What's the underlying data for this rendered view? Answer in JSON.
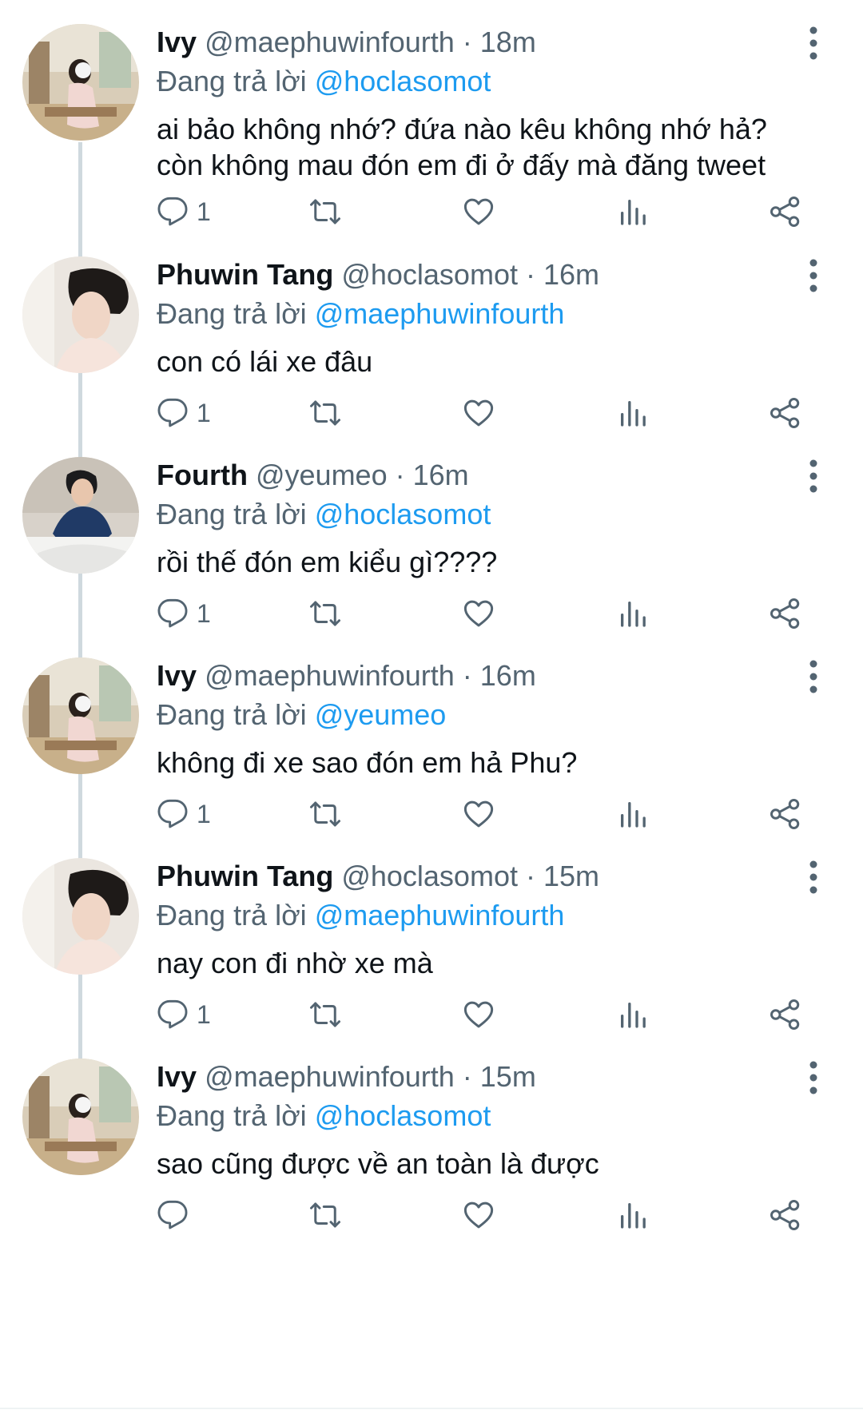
{
  "tweets": [
    {
      "author": "Ivy",
      "handle": "@maephuwinfourth",
      "time": "· 18m",
      "reply_prefix": "Đang trả lời",
      "reply_to": "@hoclasomot",
      "lines": [
        "ai bảo không nhớ? đứa nào kêu không nhớ hả?",
        "còn không mau đón em đi ở đấy mà đăng tweet"
      ],
      "reply_count": "1",
      "avatar": "ivy"
    },
    {
      "author": "Phuwin Tang",
      "handle": "@hoclasomot",
      "time": "· 16m",
      "reply_prefix": "Đang trả lời",
      "reply_to": "@maephuwinfourth",
      "lines": [
        "con có lái xe đâu"
      ],
      "reply_count": "1",
      "avatar": "phuwin"
    },
    {
      "author": "Fourth",
      "handle": "@yeumeo",
      "time": "· 16m",
      "reply_prefix": "Đang trả lời",
      "reply_to": "@hoclasomot",
      "lines": [
        "rồi thế đón em kiểu gì????"
      ],
      "reply_count": "1",
      "avatar": "fourth"
    },
    {
      "author": "Ivy",
      "handle": "@maephuwinfourth",
      "time": "· 16m",
      "reply_prefix": "Đang trả lời",
      "reply_to": "@yeumeo",
      "lines": [
        "không đi xe sao đón em hả Phu?"
      ],
      "reply_count": "1",
      "avatar": "ivy"
    },
    {
      "author": "Phuwin Tang",
      "handle": "@hoclasomot",
      "time": "· 15m",
      "reply_prefix": "Đang trả lời",
      "reply_to": "@maephuwinfourth",
      "lines": [
        "nay con đi nhờ xe mà"
      ],
      "reply_count": "1",
      "avatar": "phuwin"
    },
    {
      "author": "Ivy",
      "handle": "@maephuwinfourth",
      "time": "· 15m",
      "reply_prefix": "Đang trả lời",
      "reply_to": "@hoclasomot",
      "lines": [
        "sao cũng được về an toàn là được"
      ],
      "reply_count": "",
      "avatar": "ivy"
    }
  ],
  "icons": {
    "reply": "reply-icon",
    "retweet": "retweet-icon",
    "like": "heart-icon",
    "views": "views-icon",
    "share": "share-icon",
    "more": "more-vertical-icon"
  },
  "colors": {
    "text": "#0f1419",
    "secondary": "#536471",
    "link": "#1d9bf0",
    "thread_line": "#cfd9de"
  }
}
